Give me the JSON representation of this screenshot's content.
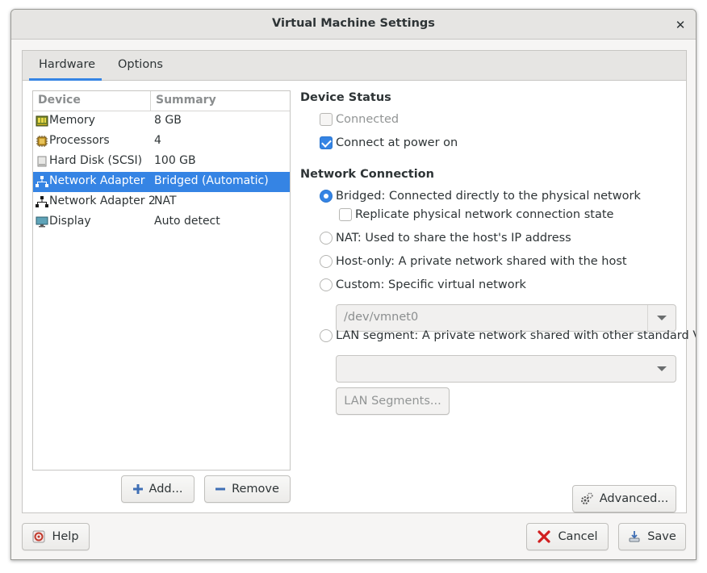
{
  "window": {
    "title": "Virtual Machine Settings"
  },
  "tabs": [
    {
      "label": "Hardware",
      "active": true
    },
    {
      "label": "Options",
      "active": false
    }
  ],
  "device_list": {
    "headers": {
      "device": "Device",
      "summary": "Summary"
    },
    "rows": [
      {
        "device": "Memory",
        "summary": "8 GB",
        "icon": "memory-icon",
        "selected": false
      },
      {
        "device": "Processors",
        "summary": "4",
        "icon": "processor-icon",
        "selected": false
      },
      {
        "device": "Hard Disk (SCSI)",
        "summary": "100 GB",
        "icon": "hard-disk-icon",
        "selected": false
      },
      {
        "device": "Network Adapter",
        "summary": "Bridged (Automatic)",
        "icon": "network-adapter-icon",
        "selected": true
      },
      {
        "device": "Network Adapter 2",
        "summary": "NAT",
        "icon": "network-adapter-icon",
        "selected": false
      },
      {
        "device": "Display",
        "summary": "Auto detect",
        "icon": "display-icon",
        "selected": false
      }
    ]
  },
  "list_buttons": {
    "add": "Add...",
    "remove": "Remove"
  },
  "device_status": {
    "title": "Device Status",
    "connected": {
      "label": "Connected",
      "checked": false,
      "enabled": false
    },
    "connect_at_power_on": {
      "label": "Connect at power on",
      "checked": true,
      "enabled": true
    }
  },
  "network_connection": {
    "title": "Network Connection",
    "bridged": {
      "label": "Bridged: Connected directly to the physical network",
      "selected": true
    },
    "replicate": {
      "label": "Replicate physical network connection state",
      "checked": false
    },
    "nat": {
      "label": "NAT: Used to share the host's IP address",
      "selected": false
    },
    "host_only": {
      "label": "Host-only: A private network shared with the host",
      "selected": false
    },
    "custom": {
      "label": "Custom: Specific virtual network",
      "selected": false,
      "value": "/dev/vmnet0"
    },
    "lan_segment": {
      "label": "LAN segment: A private network shared with other standard VMs",
      "selected": false,
      "value": ""
    },
    "lan_segments_button": "LAN Segments..."
  },
  "advanced_button": "Advanced...",
  "footer": {
    "help": "Help",
    "cancel": "Cancel",
    "save": "Save"
  },
  "colors": {
    "accent": "#3584e4",
    "window_bg": "#f6f5f4"
  }
}
